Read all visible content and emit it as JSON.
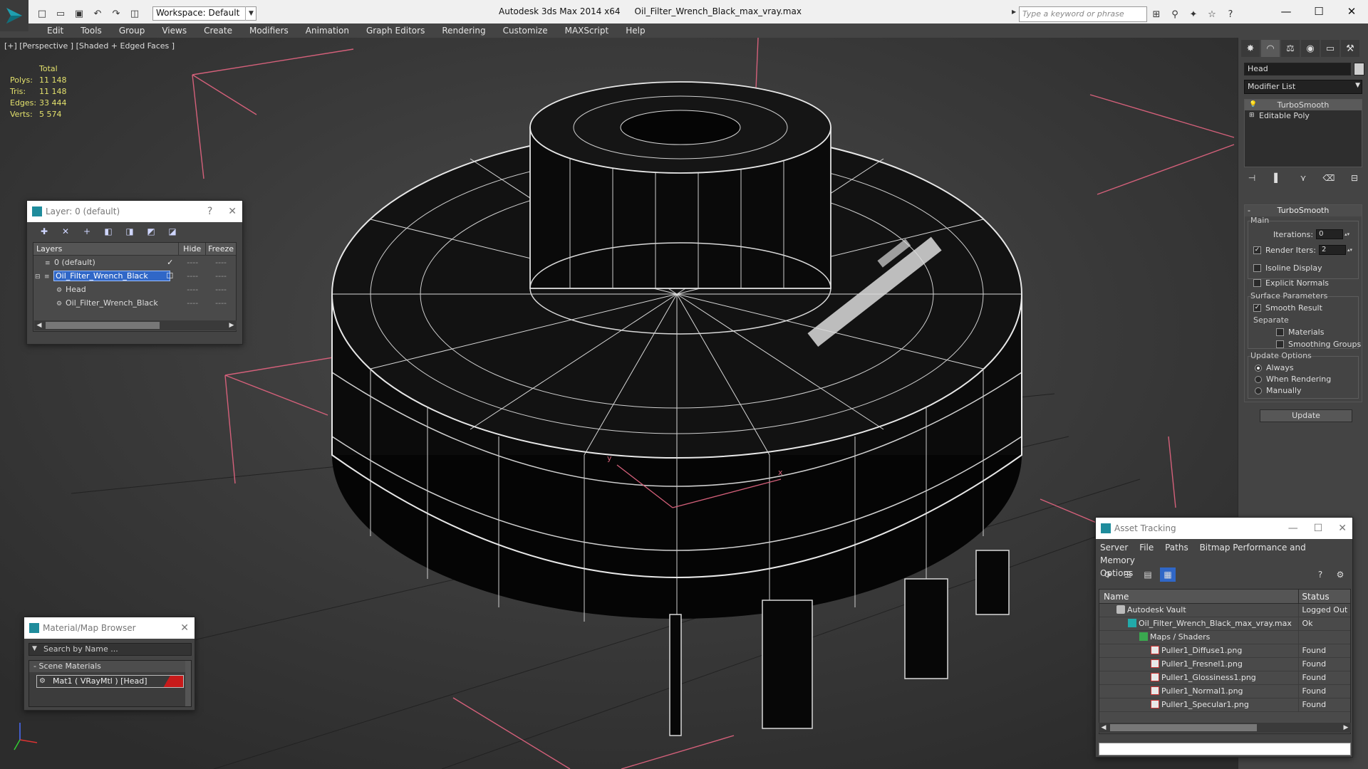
{
  "app": {
    "title_app": "Autodesk 3ds Max  2014 x64",
    "title_file": "Oil_Filter_Wrench_Black_max_vray.max",
    "workspace": "Workspace: Default",
    "search_placeholder": "Type a keyword or phrase"
  },
  "menu": [
    "Edit",
    "Tools",
    "Group",
    "Views",
    "Create",
    "Modifiers",
    "Animation",
    "Graph Editors",
    "Rendering",
    "Customize",
    "MAXScript",
    "Help"
  ],
  "viewport": {
    "label": "[+] [Perspective ] [Shaded + Edged Faces ]",
    "stats_header": "Total",
    "stats": [
      {
        "name": "Polys:",
        "value": "11 148"
      },
      {
        "name": "Tris:",
        "value": "11 148"
      },
      {
        "name": "Edges:",
        "value": "33 444"
      },
      {
        "name": "Verts:",
        "value": "5 574"
      }
    ],
    "axis_x": "x",
    "axis_y": "y"
  },
  "command_panel": {
    "object_name": "Head",
    "modifier_list": "Modifier List",
    "stack": [
      "TurboSmooth",
      "Editable Poly"
    ],
    "turbosmooth": {
      "title": "TurboSmooth",
      "main_label": "Main",
      "iterations_label": "Iterations:",
      "iterations_value": "0",
      "render_iters_label": "Render Iters:",
      "render_iters_value": "2",
      "isoline_label": "Isoline Display",
      "explicit_label": "Explicit Normals",
      "surface_label": "Surface Parameters",
      "smooth_label": "Smooth Result",
      "separate_label": "Separate",
      "materials_label": "Materials",
      "smoothing_groups_label": "Smoothing Groups",
      "update_options_label": "Update Options",
      "always_label": "Always",
      "when_rendering_label": "When Rendering",
      "manually_label": "Manually",
      "update_button": "Update"
    }
  },
  "layer_panel": {
    "title": "Layer: 0 (default)",
    "col_layers": "Layers",
    "col_hide": "Hide",
    "col_freeze": "Freeze",
    "rows": [
      {
        "name": "0 (default)",
        "hide": "----",
        "freeze": "----"
      },
      {
        "name": "Oil_Filter_Wrench_Black",
        "hide": "----",
        "freeze": "----"
      },
      {
        "name": "Head",
        "hide": "----",
        "freeze": "----"
      },
      {
        "name": "Oil_Filter_Wrench_Black",
        "hide": "----",
        "freeze": "----"
      }
    ]
  },
  "material_browser": {
    "title": "Material/Map Browser",
    "search_placeholder": "Search by Name ...",
    "group": "- Scene Materials",
    "item": "Mat1  ( VRayMtl ) [Head]"
  },
  "asset_tracking": {
    "title": "Asset Tracking",
    "menu": [
      "Server",
      "File",
      "Paths",
      "Bitmap Performance and Memory"
    ],
    "menu2": "Options",
    "col_name": "Name",
    "col_status": "Status",
    "rows": [
      {
        "name": "Autodesk Vault",
        "status": "Logged Out",
        "indent": 1,
        "icon": "vault"
      },
      {
        "name": "Oil_Filter_Wrench_Black_max_vray.max",
        "status": "Ok",
        "indent": 2,
        "icon": "max"
      },
      {
        "name": "Maps / Shaders",
        "status": "",
        "indent": 3,
        "icon": "maps"
      },
      {
        "name": "Puller1_Diffuse1.png",
        "status": "Found",
        "indent": 4,
        "icon": "png"
      },
      {
        "name": "Puller1_Fresnel1.png",
        "status": "Found",
        "indent": 4,
        "icon": "png"
      },
      {
        "name": "Puller1_Glossiness1.png",
        "status": "Found",
        "indent": 4,
        "icon": "png"
      },
      {
        "name": "Puller1_Normal1.png",
        "status": "Found",
        "indent": 4,
        "icon": "png"
      },
      {
        "name": "Puller1_Specular1.png",
        "status": "Found",
        "indent": 4,
        "icon": "png"
      }
    ]
  }
}
